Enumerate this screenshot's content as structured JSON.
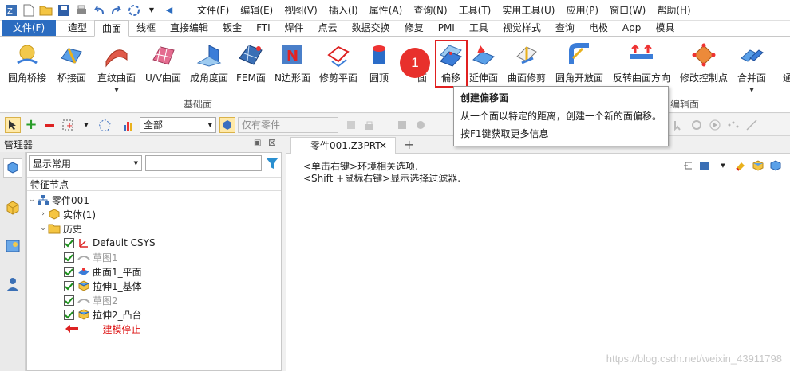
{
  "menubar": {
    "menus": [
      "文件(F)",
      "编辑(E)",
      "视图(V)",
      "插入(I)",
      "属性(A)",
      "查询(N)",
      "工具(T)",
      "实用工具(U)",
      "应用(P)",
      "窗口(W)",
      "帮助(H)"
    ]
  },
  "tabs": {
    "file": "文件(F)",
    "items": [
      "造型",
      "曲面",
      "线框",
      "直接编辑",
      "钣金",
      "FTI",
      "焊件",
      "点云",
      "数据交换",
      "修复",
      "PMI",
      "工具",
      "视觉样式",
      "查询",
      "电极",
      "App",
      "模具"
    ],
    "active": "曲面"
  },
  "ribbon": {
    "basic_buttons": [
      "圆角桥接",
      "桥接面",
      "直纹曲面",
      "U/V曲面",
      "成角度面",
      "FEM面",
      "N边形面",
      "修剪平面",
      "圆顶"
    ],
    "edit_buttons": [
      "面",
      "偏移",
      "延伸面",
      "曲面修剪",
      "圆角开放面",
      "反转曲面方向",
      "修改控制点",
      "合并面",
      "通"
    ],
    "basic_group": "基础面",
    "edit_group": "编辑面",
    "callout_number": "1"
  },
  "tooltip": {
    "title": "创建偏移面",
    "desc": "从一个面以特定的距离，创建一个新的面偏移。",
    "help": "按F1键获取更多信息"
  },
  "toolbar": {
    "filter_value": "全部",
    "part_filter": "仅有零件"
  },
  "manager": {
    "title": "管理器",
    "display_filter": "显示常用",
    "column_header": "特征节点",
    "tree": {
      "root": "零件001",
      "solid": "实体(1)",
      "history": "历史",
      "csys": "Default CSYS",
      "sketch1": "草图1",
      "surface1": "曲面1_平面",
      "extrude1": "拉伸1_基体",
      "sketch2": "草图2",
      "extrude2": "拉伸2_凸台",
      "stop": "----- 建模停止 -----"
    }
  },
  "document": {
    "tab_label": "零件001.Z3PRT",
    "hint1": "<单击右键>环境相关选项.",
    "hint2": "<Shift +鼠标右键>显示选择过滤器."
  },
  "watermark": "https://blog.csdn.net/weixin_43911798",
  "colors": {
    "accent": "#2b6cc0",
    "highlight": "#e02020",
    "badge": "#e8302c"
  }
}
